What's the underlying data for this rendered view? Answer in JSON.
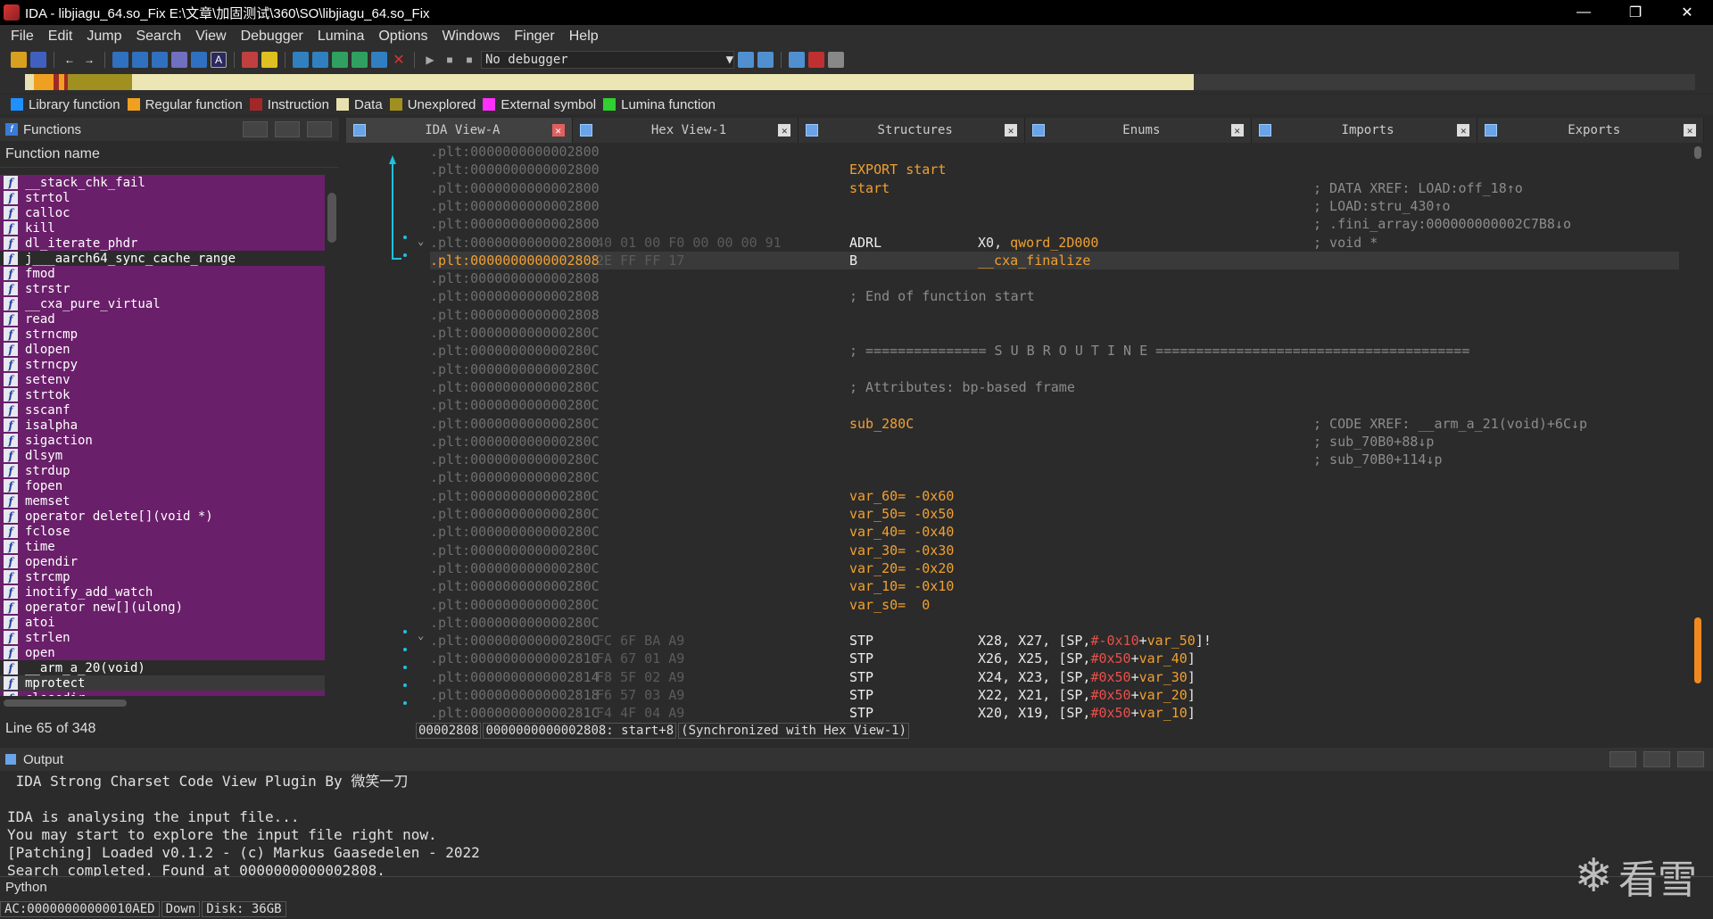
{
  "window": {
    "title": "IDA - libjiagu_64.so_Fix E:\\文章\\加固测试\\360\\SO\\libjiagu_64.so_Fix",
    "min": "—",
    "max": "❐",
    "close": "✕"
  },
  "menu": [
    "File",
    "Edit",
    "Jump",
    "Search",
    "View",
    "Debugger",
    "Lumina",
    "Options",
    "Windows",
    "Finger",
    "Help"
  ],
  "toolbar": {
    "debugger": "No debugger"
  },
  "legend": [
    {
      "label": "Library function",
      "color": "#1e90ff"
    },
    {
      "label": "Regular function",
      "color": "#f0a020"
    },
    {
      "label": "Instruction",
      "color": "#a02828"
    },
    {
      "label": "Data",
      "color": "#e8e0b0"
    },
    {
      "label": "Unexplored",
      "color": "#a09020"
    },
    {
      "label": "External symbol",
      "color": "#ff30ff"
    },
    {
      "label": "Lumina function",
      "color": "#30d030"
    }
  ],
  "functions": {
    "title": "Functions",
    "column": "Function name",
    "line_count": "Line 65 of 348",
    "items": [
      {
        "name": "__stack_chk_fail",
        "style": "ext"
      },
      {
        "name": "strtol",
        "style": "ext"
      },
      {
        "name": "calloc",
        "style": "ext"
      },
      {
        "name": "kill",
        "style": "ext"
      },
      {
        "name": "dl_iterate_phdr",
        "style": "ext"
      },
      {
        "name": "j___aarch64_sync_cache_range",
        "style": "plain"
      },
      {
        "name": "fmod",
        "style": "ext"
      },
      {
        "name": "strstr",
        "style": "ext"
      },
      {
        "name": "__cxa_pure_virtual",
        "style": "ext"
      },
      {
        "name": "read",
        "style": "ext"
      },
      {
        "name": "strncmp",
        "style": "ext"
      },
      {
        "name": "dlopen",
        "style": "ext"
      },
      {
        "name": "strncpy",
        "style": "ext"
      },
      {
        "name": "setenv",
        "style": "ext"
      },
      {
        "name": "strtok",
        "style": "ext"
      },
      {
        "name": "sscanf",
        "style": "ext"
      },
      {
        "name": "isalpha",
        "style": "ext"
      },
      {
        "name": "sigaction",
        "style": "ext"
      },
      {
        "name": "dlsym",
        "style": "ext"
      },
      {
        "name": "strdup",
        "style": "ext"
      },
      {
        "name": "fopen",
        "style": "ext"
      },
      {
        "name": "memset",
        "style": "ext"
      },
      {
        "name": "operator delete[](void *)",
        "style": "ext"
      },
      {
        "name": "fclose",
        "style": "ext"
      },
      {
        "name": "time",
        "style": "ext"
      },
      {
        "name": "opendir",
        "style": "ext"
      },
      {
        "name": "strcmp",
        "style": "ext"
      },
      {
        "name": "inotify_add_watch",
        "style": "ext"
      },
      {
        "name": "operator new[](ulong)",
        "style": "ext"
      },
      {
        "name": "atoi",
        "style": "ext"
      },
      {
        "name": "strlen",
        "style": "ext"
      },
      {
        "name": "open",
        "style": "ext"
      },
      {
        "name": "__arm_a_20(void)",
        "style": "plain"
      },
      {
        "name": "mprotect",
        "style": "sel"
      },
      {
        "name": "closedir",
        "style": "ext"
      }
    ]
  },
  "tabs": [
    {
      "label": "IDA View-A",
      "active": true
    },
    {
      "label": "Hex View-1",
      "active": false
    },
    {
      "label": "Structures",
      "active": false
    },
    {
      "label": "Enums",
      "active": false
    },
    {
      "label": "Imports",
      "active": false
    },
    {
      "label": "Exports",
      "active": false
    }
  ],
  "disasm": [
    {
      "addr": ".plt:0000000000002800"
    },
    {
      "addr": ".plt:0000000000002800",
      "label": "EXPORT start"
    },
    {
      "addr": ".plt:0000000000002800",
      "label": "start",
      "comment": "; DATA XREF: LOAD:off_18↑o"
    },
    {
      "addr": ".plt:0000000000002800",
      "comment": "; LOAD:stru_430↑o"
    },
    {
      "addr": ".plt:0000000000002800",
      "comment": "; .fini_array:000000000002C7B8↓o"
    },
    {
      "addr": ".plt:0000000000002800",
      "bytes": "40 01 00 F0 00 00 00 91",
      "mn": "ADRL",
      "op": "X0, qword_2D000",
      "comment": "; void *"
    },
    {
      "addr": ".plt:0000000000002808",
      "bytes": "2E FF FF 17",
      "mn": "B",
      "op": "__cxa_finalize",
      "hl": true
    },
    {
      "addr": ".plt:0000000000002808"
    },
    {
      "addr": ".plt:0000000000002808",
      "note": "; End of function start"
    },
    {
      "addr": ".plt:0000000000002808"
    },
    {
      "addr": ".plt:000000000000280C"
    },
    {
      "addr": ".plt:000000000000280C",
      "note": "; =============== S U B R O U T I N E ======================================="
    },
    {
      "addr": ".plt:000000000000280C"
    },
    {
      "addr": ".plt:000000000000280C",
      "note": "; Attributes: bp-based frame"
    },
    {
      "addr": ".plt:000000000000280C"
    },
    {
      "addr": ".plt:000000000000280C",
      "label": "sub_280C",
      "comment": "; CODE XREF: __arm_a_21(void)+6C↓p"
    },
    {
      "addr": ".plt:000000000000280C",
      "comment": "; sub_70B0+88↓p"
    },
    {
      "addr": ".plt:000000000000280C",
      "comment": "; sub_70B0+114↓p"
    },
    {
      "addr": ".plt:000000000000280C"
    },
    {
      "addr": ".plt:000000000000280C",
      "label": "var_60= -0x60"
    },
    {
      "addr": ".plt:000000000000280C",
      "label": "var_50= -0x50"
    },
    {
      "addr": ".plt:000000000000280C",
      "label": "var_40= -0x40"
    },
    {
      "addr": ".plt:000000000000280C",
      "label": "var_30= -0x30"
    },
    {
      "addr": ".plt:000000000000280C",
      "label": "var_20= -0x20"
    },
    {
      "addr": ".plt:000000000000280C",
      "label": "var_10= -0x10"
    },
    {
      "addr": ".plt:000000000000280C",
      "label": "var_s0=  0"
    },
    {
      "addr": ".plt:000000000000280C"
    },
    {
      "addr": ".plt:000000000000280C",
      "bytes": "FC 6F BA A9",
      "mn": "STP",
      "op": "X28, X27, [SP,#-0x10+var_50]!"
    },
    {
      "addr": ".plt:0000000000002810",
      "bytes": "FA 67 01 A9",
      "mn": "STP",
      "op": "X26, X25, [SP,#0x50+var_40]"
    },
    {
      "addr": ".plt:0000000000002814",
      "bytes": "F8 5F 02 A9",
      "mn": "STP",
      "op": "X24, X23, [SP,#0x50+var_30]"
    },
    {
      "addr": ".plt:0000000000002818",
      "bytes": "F6 57 03 A9",
      "mn": "STP",
      "op": "X22, X21, [SP,#0x50+var_20]"
    },
    {
      "addr": ".plt:000000000000281C",
      "bytes": "F4 4F 04 A9",
      "mn": "STP",
      "op": "X20, X19, [SP,#0x50+var_10]"
    }
  ],
  "status": [
    "00002808",
    "0000000000002808: start+8",
    "(Synchronized with Hex View-1)"
  ],
  "output": {
    "title": "Output",
    "lines": [
      " IDA Strong Charset Code View Plugin By 微笑一刀",
      "",
      "IDA is analysing the input file...",
      "You may start to explore the input file right now.",
      "[Patching] Loaded v0.1.2 - (c) Markus Gaasedelen - 2022",
      "Search completed. Found at 0000000000002808."
    ],
    "python": "Python"
  },
  "bottom": [
    "AC:00000000000010AED",
    "Down",
    "Disk: 36GB"
  ],
  "watermark": "看雪"
}
